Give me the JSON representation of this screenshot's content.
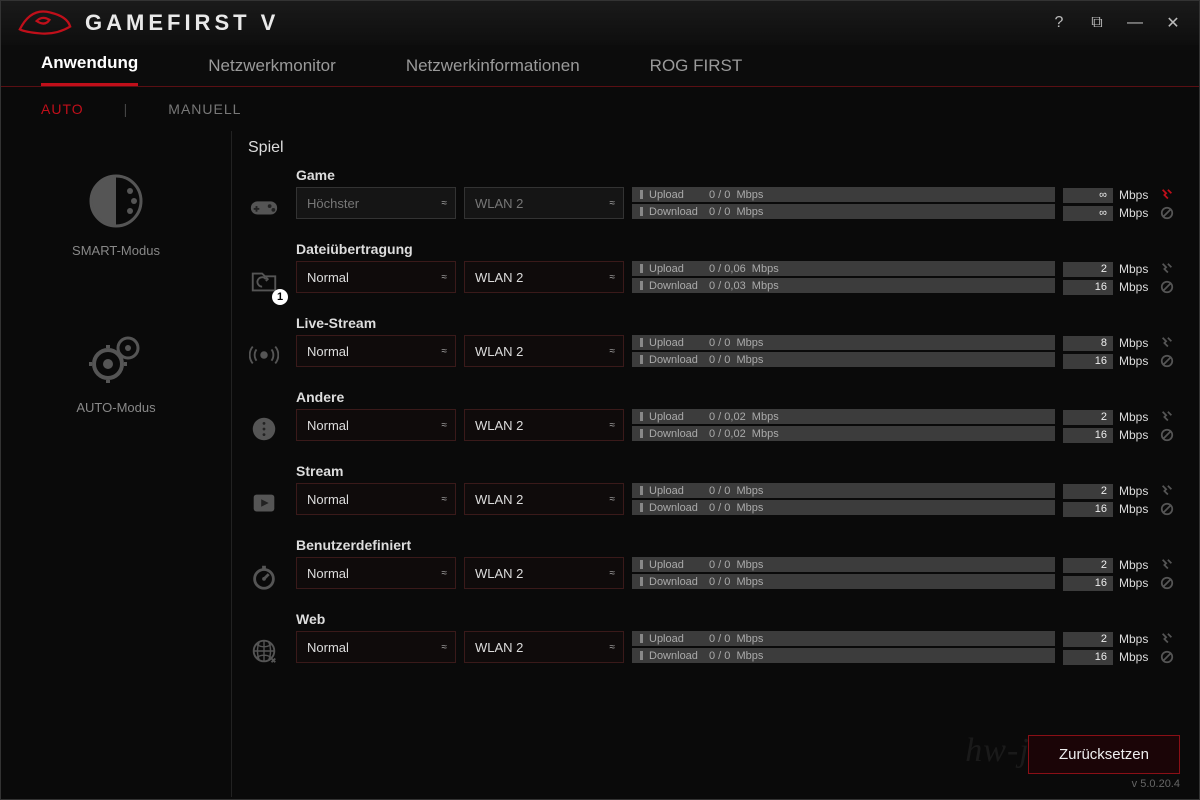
{
  "app_title": "GAMEFIRST V",
  "window_controls": {
    "help": "?",
    "link": "⧉",
    "min": "—",
    "close": "✕"
  },
  "main_nav": [
    "Anwendung",
    "Netzwerkmonitor",
    "Netzwerkinformationen",
    "ROG FIRST"
  ],
  "sub_nav": [
    "AUTO",
    "MANUELL"
  ],
  "side_modes": [
    "SMART-Modus",
    "AUTO-Modus"
  ],
  "section_title": "Spiel",
  "labels": {
    "upload": "Upload",
    "download": "Download",
    "mbps": "Mbps",
    "infinity": "∞"
  },
  "categories": [
    {
      "name": "Game",
      "priority": "Höchster",
      "priority_disabled": true,
      "iface": "WLAN 2",
      "iface_disabled": true,
      "upload": "0 / 0",
      "download": "0 / 0",
      "up_limit": "∞",
      "down_limit": "∞",
      "up_alert": true,
      "badge": null
    },
    {
      "name": "Dateiübertragung",
      "priority": "Normal",
      "iface": "WLAN 2",
      "upload": "0 / 0,06",
      "download": "0 / 0,03",
      "up_limit": "2",
      "down_limit": "16",
      "badge": "1"
    },
    {
      "name": "Live-Stream",
      "priority": "Normal",
      "iface": "WLAN 2",
      "upload": "0 / 0",
      "download": "0 / 0",
      "up_limit": "8",
      "down_limit": "16"
    },
    {
      "name": "Andere",
      "priority": "Normal",
      "iface": "WLAN 2",
      "upload": "0 / 0,02",
      "download": "0 / 0,02",
      "up_limit": "2",
      "down_limit": "16"
    },
    {
      "name": "Stream",
      "priority": "Normal",
      "iface": "WLAN 2",
      "upload": "0 / 0",
      "download": "0 / 0",
      "up_limit": "2",
      "down_limit": "16"
    },
    {
      "name": "Benutzerdefiniert",
      "priority": "Normal",
      "iface": "WLAN 2",
      "upload": "0 / 0",
      "download": "0 / 0",
      "up_limit": "2",
      "down_limit": "16"
    },
    {
      "name": "Web",
      "priority": "Normal",
      "iface": "WLAN 2",
      "upload": "0 / 0",
      "download": "0 / 0",
      "up_limit": "2",
      "down_limit": "16"
    }
  ],
  "reset_label": "Zurücksetzen",
  "version": "v 5.0.20.4",
  "watermark": "hw-journal.de"
}
